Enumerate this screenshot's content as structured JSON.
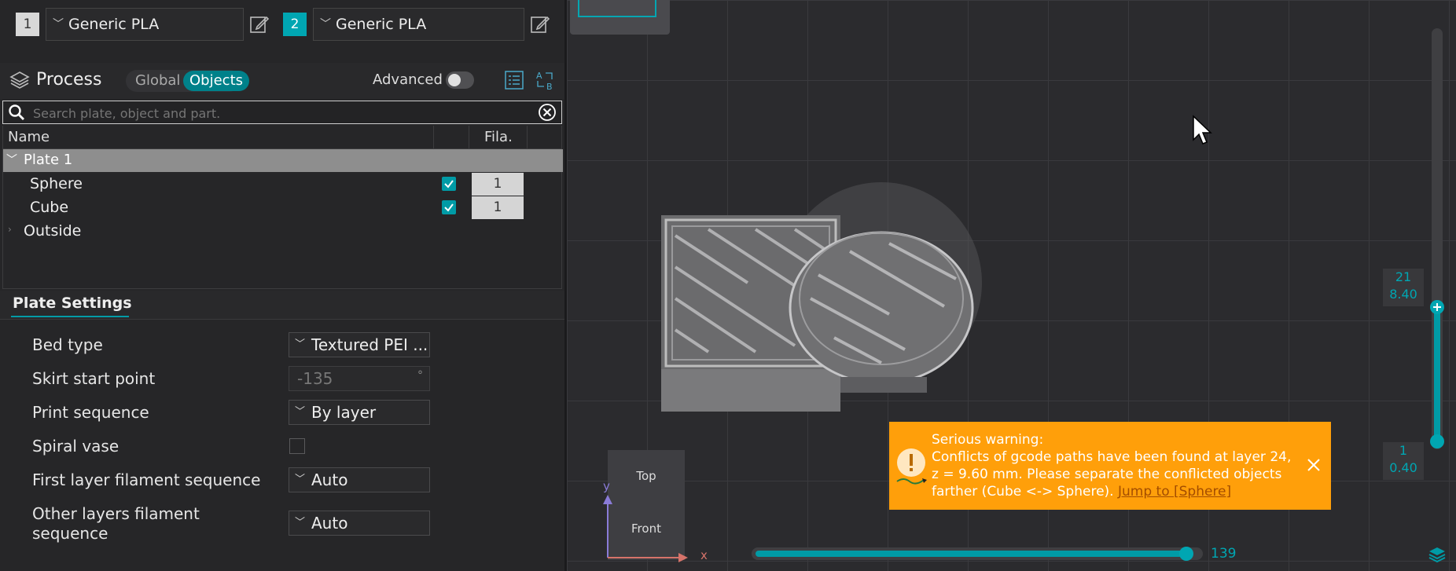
{
  "filaments": [
    {
      "num": "1",
      "name": "Generic PLA"
    },
    {
      "num": "2",
      "name": "Generic PLA"
    }
  ],
  "process": {
    "title": "Process",
    "tab_global": "Global",
    "tab_objects": "Objects",
    "advanced_label": "Advanced"
  },
  "search": {
    "placeholder": "Search plate, object and part."
  },
  "tree": {
    "col_name": "Name",
    "col_fila": "Fila.",
    "plate": "Plate 1",
    "items": [
      {
        "name": "Sphere",
        "fila": "1"
      },
      {
        "name": "Cube",
        "fila": "1"
      }
    ],
    "outside": "Outside"
  },
  "plate_settings": {
    "title": "Plate Settings",
    "rows": [
      {
        "label": "Bed type",
        "value": "Textured PEI ..."
      },
      {
        "label": "Skirt start point",
        "value": "-135",
        "unit": "°"
      },
      {
        "label": "Print sequence",
        "value": "By layer"
      },
      {
        "label": "Spiral vase",
        "value": ""
      },
      {
        "label": "First layer filament sequence",
        "value": "Auto"
      },
      {
        "label": "Other layers filament sequence",
        "value": "Auto"
      }
    ]
  },
  "viewport": {
    "axis_cube_top": "Top",
    "axis_cube_front": "Front",
    "axis_x": "x",
    "axis_y": "y",
    "layer_top_num": "21",
    "layer_top_height": "8.40",
    "layer_bottom_num": "1",
    "layer_bottom_height": "0.40",
    "move_value": "139"
  },
  "warning": {
    "title": "Serious warning:",
    "line1": "Conflicts of gcode paths have been found at layer 24,",
    "line2": "z = 9.60 mm. Please separate the conflicted objects",
    "line3": "farther (Cube <-> Sphere).",
    "link": "Jump to [Sphere]"
  },
  "colors": {
    "accent": "#009ba6",
    "warning_bg": "#ff9f0a",
    "panel_bg": "#262628"
  }
}
